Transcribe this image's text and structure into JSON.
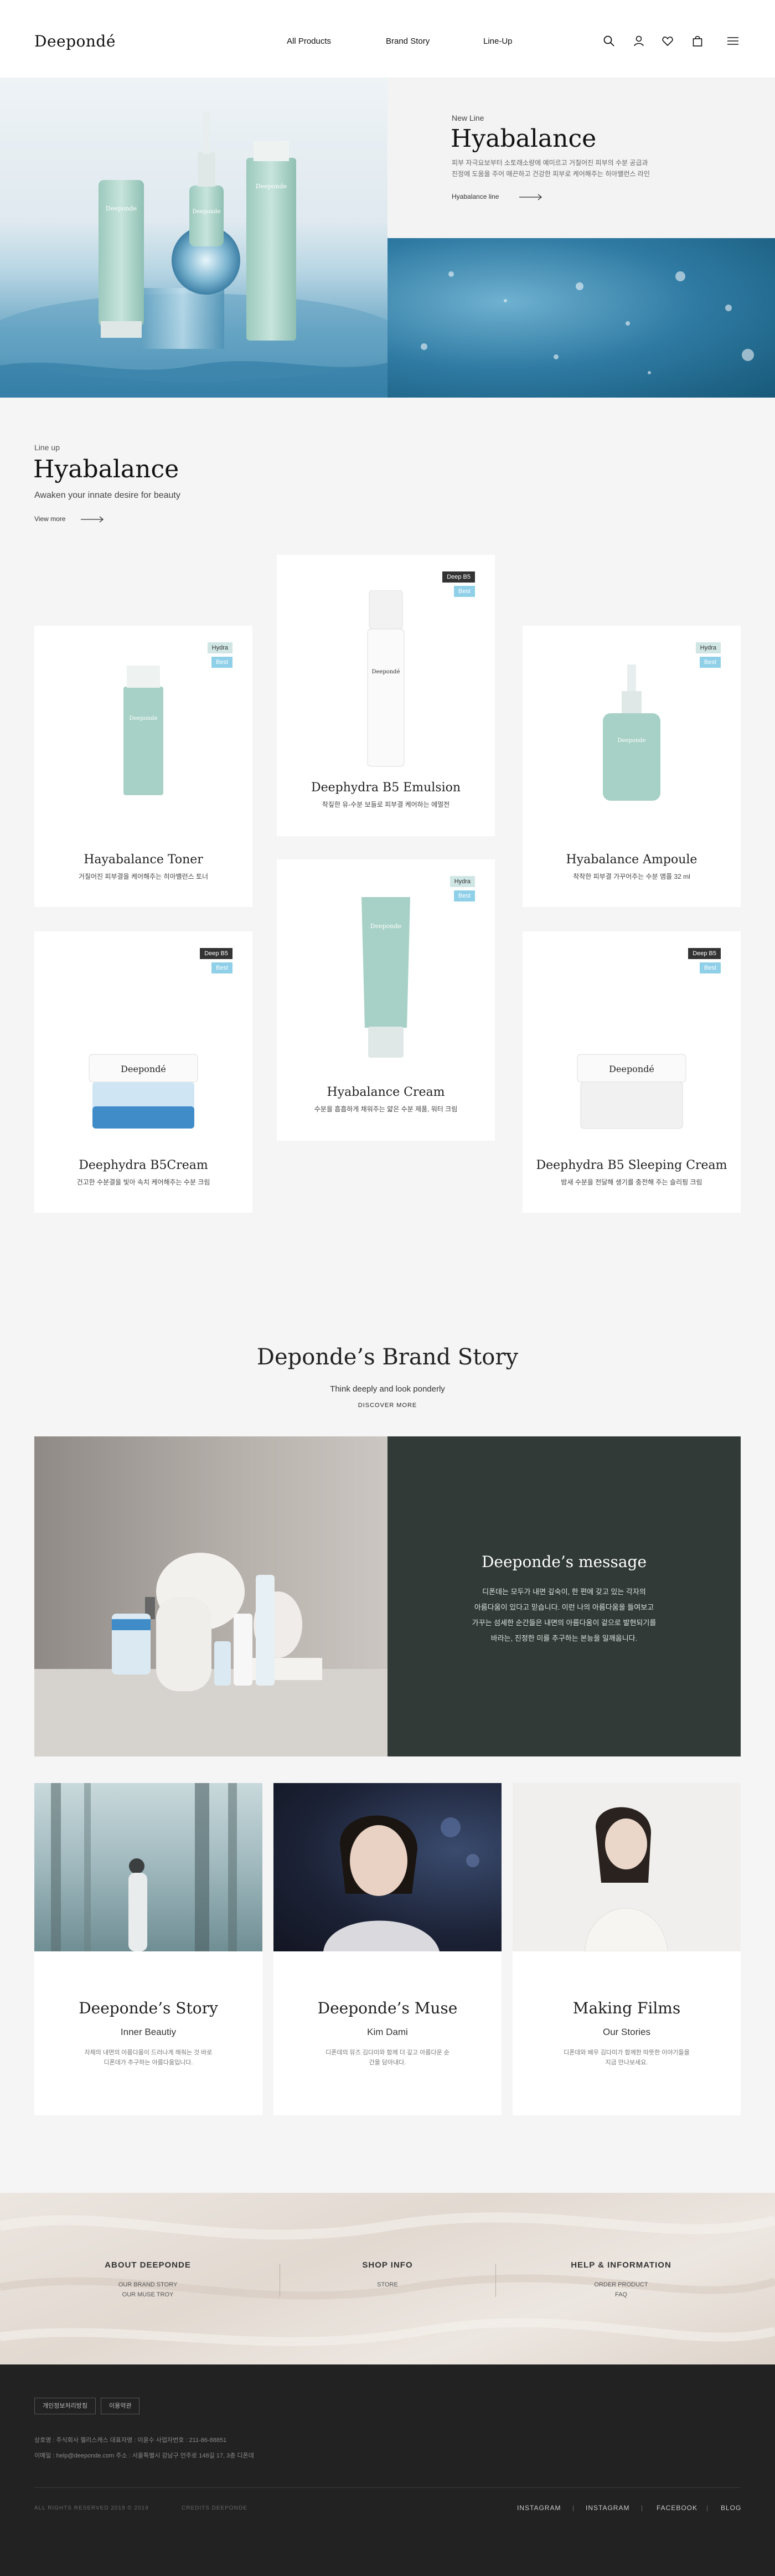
{
  "header": {
    "logo": "Deepondé",
    "nav": [
      "All Products",
      "Brand Story",
      "Line-Up"
    ],
    "icons": [
      "search-icon",
      "user-icon",
      "heart-icon",
      "bag-icon",
      "menu-icon"
    ]
  },
  "hero": {
    "eyebrow": "New Line",
    "title": "Hyabalance",
    "desc_line1": "피부 자극요보부터 소토래소량에 예미르고 거칠어진 피부의 수분 공급과",
    "desc_line2": "진정에 도움을 주어 매끈하고 건강한 피부로 케어해주는 히아밸런스 라인",
    "link": "Hyabalance line"
  },
  "lineup": {
    "eyebrow": "Line up",
    "title": "Hyabalance",
    "subtitle": "Awaken your innate desire for beauty",
    "view_more": "View more"
  },
  "products": [
    {
      "name": "Hayabalance Toner",
      "desc": "거칠어진 피부결을 케어해주는 히아밸런스 토너",
      "badge1": "Hydra",
      "badge2": "Best",
      "bottle": "Deeponde"
    },
    {
      "name": "Deephydra B5 Emulsion",
      "desc": "착짚한 유-수분 보들로 피부결 케어하는 에멀전",
      "badge1": "Deep B5",
      "badge2": "Best",
      "bottle": "Deepondé"
    },
    {
      "name": "Hyabalance Ampoule",
      "desc": "착착한 피부결 가꾸어주는 수분 앰플 32 ml",
      "badge1": "Hydra",
      "badge2": "Best",
      "bottle": "Deeponde"
    },
    {
      "name": "Deephydra B5Cream",
      "desc": "건고한 수분결을 빛아 속치 케어해주는 수분 크림",
      "badge1": "Deep B5",
      "badge2": "Best",
      "bottle": "Deepondé"
    },
    {
      "name": "Hyabalance Cream",
      "desc": "수분을 흡흡하게 채워주는 얇은 수분 제품, 워터 크림",
      "badge1": "Hydra",
      "badge2": "Best",
      "bottle": "Deeponde"
    },
    {
      "name": "Deephydra B5 Sleeping Cream",
      "desc": "밤새 수분을 전달해 생기를 충전해 주는 슬리핑 크림",
      "badge1": "Deep B5",
      "badge2": "Best",
      "bottle": "Deepondé"
    }
  ],
  "brand_story": {
    "title": "Deponde’s Brand Story",
    "subtitle": "Think deeply and look ponderly",
    "link": "DISCOVER MORE",
    "message_title": "Deeponde’s message",
    "message_lines": [
      "디폰데는 모두가 내면 깊숙이, 한 편에 갖고 있는 각자의",
      "아름다움이 있다고 믿습니다. 이런 나의 아름다움을 들여보고",
      "가꾸는 섬세한 순간들은 내면의 아름다움이 겉으로 발현되기를",
      "바라는, 진정한 미를 추구하는 본능을 일깨웁니다."
    ]
  },
  "stories": [
    {
      "title": "Deeponde’s Story",
      "sub": "Inner Beautiy",
      "desc": "자체의 내면의 아름다움이 드러나게 해줘는 것 바로 디폰데가 추구하는 아름다움입니다."
    },
    {
      "title": "Deeponde’s Muse",
      "sub": "Kim Dami",
      "desc": "디폰데의 뮤즈 김다미와 함께 더 깊고 아름다운 순간을 담아내다."
    },
    {
      "title": "Making Films",
      "sub": "Our Stories",
      "desc": "디폰데와 배우 김다미가 함께한 따뜻한 이야기들을 지금 만나보세요."
    }
  ],
  "footer": {
    "col1_title": "ABOUT DEEPONDE",
    "col1_links": [
      "OUR BRAND STORY",
      "OUR MUSE TROY"
    ],
    "col2_title": "SHOP INFO",
    "col2_links": [
      "STORE"
    ],
    "col3_title": "HELP & INFORMATION",
    "col3_links": [
      "ORDER PRODUCT",
      "FAQ"
    ],
    "btn1": "개인정보처리방침",
    "btn2": "이용약관",
    "info1": "상호명 : 주식회사 젤리스캐스    대표자명 : 이윤수    사업자번호 : 211-86-88851",
    "info2": "이메일 : help@deeponde.com    주소 : 서울특별시 강남구 언주로 148길 17, 3층 디폰데",
    "copyright": "ALL RIGHTS RESERVED 2019 © 2019",
    "credits": "CREDITS DEEPONDE",
    "sns": [
      "INSTAGRAM",
      "INSTAGRAM",
      "FACEBOOK",
      "BLOG"
    ]
  }
}
